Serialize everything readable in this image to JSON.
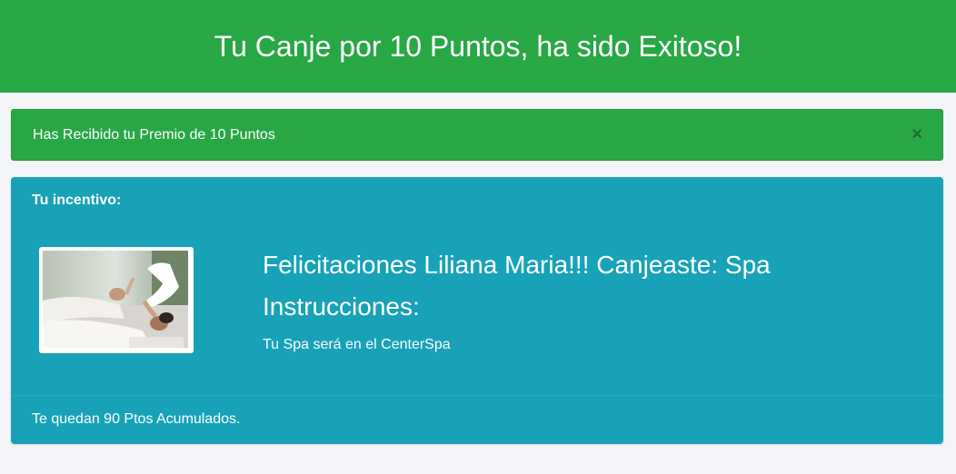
{
  "header": {
    "title": "Tu Canje por 10 Puntos, ha sido Exitoso!"
  },
  "alert": {
    "message": "Has Recibido tu Premio de 10 Puntos",
    "close_symbol": "×"
  },
  "incentive": {
    "heading": "Tu incentivo:",
    "congrats": "Felicitaciones Liliana Maria!!! Canjeaste: Spa",
    "instructions_label": "Instrucciones:",
    "instructions_text": "Tu Spa será en el CenterSpa",
    "remaining": "Te quedan 90 Ptos Acumulados.",
    "image_icon": "spa-massage-photo"
  },
  "colors": {
    "header_green": "#28a745",
    "panel_teal": "#17a2b8",
    "background": "#f4f5f8"
  }
}
